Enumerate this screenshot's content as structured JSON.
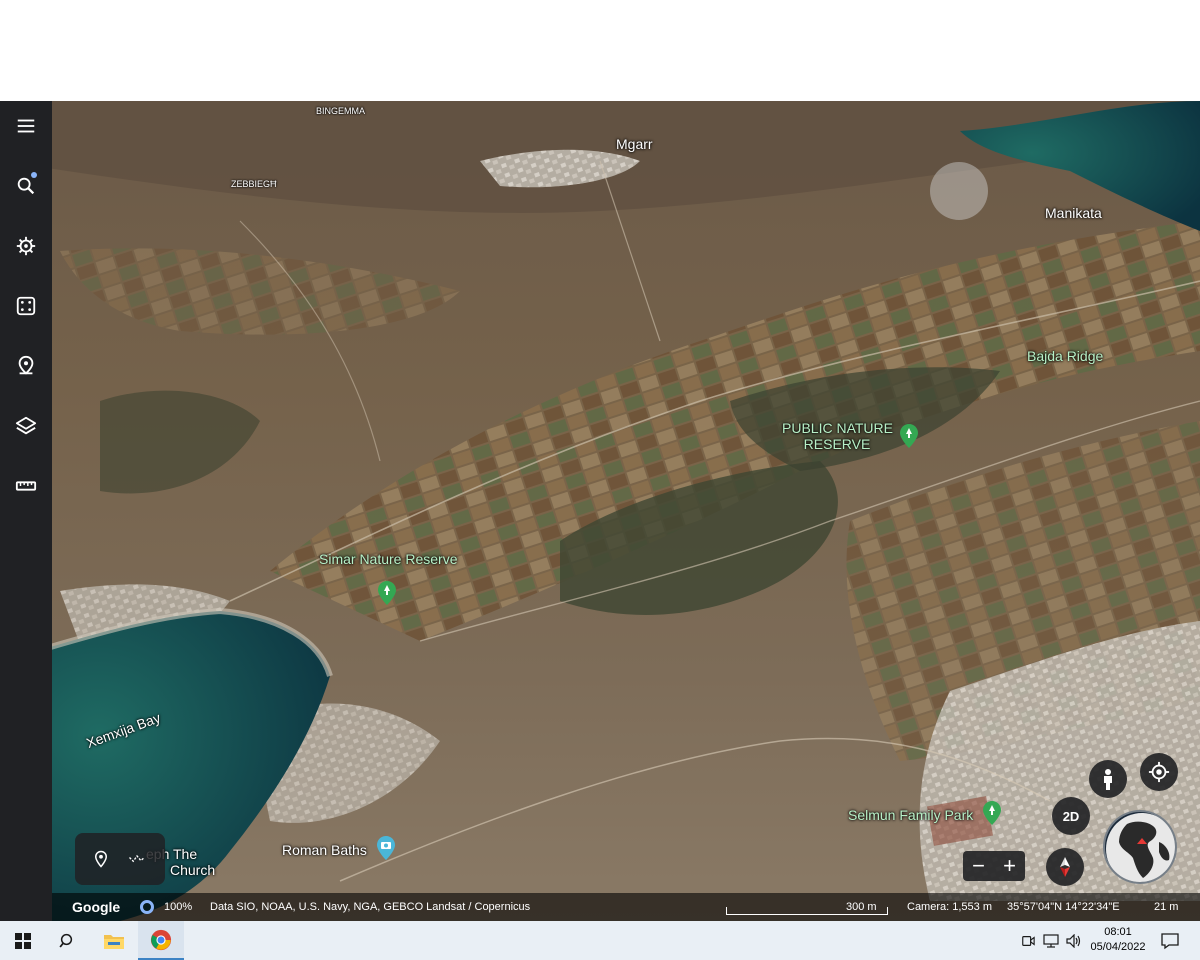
{
  "map": {
    "places": {
      "bingemma": "BINGEMMA",
      "mgarr": "Mgarr",
      "zebbiegh": "ZEBBIEGĦ",
      "manikata": "Manikata",
      "bajda": "Bajda Ridge",
      "public_reserve_line1": "PUBLIC NATURE",
      "public_reserve_line2": "RESERVE",
      "simar": "Simar Nature Reserve",
      "xemxija": "Xemxija Bay",
      "church_line1": "eph The",
      "church_line2": "Church",
      "roman_baths": "Roman Baths",
      "selmun": "Selmun Family Park"
    }
  },
  "sidebar": {
    "items": [
      {
        "icon": "menu-icon"
      },
      {
        "icon": "search-icon"
      },
      {
        "icon": "voyager-icon"
      },
      {
        "icon": "dice-icon"
      },
      {
        "icon": "projects-icon"
      },
      {
        "icon": "layers-icon"
      },
      {
        "icon": "ruler-icon"
      }
    ]
  },
  "controls": {
    "mode_2d": "2D",
    "zoom_out": "−",
    "zoom_in": "+"
  },
  "status": {
    "brand": "Google",
    "progress": "100%",
    "attribution": "Data SIO, NOAA, U.S. Navy, NGA, GEBCO  Landsat / Copernicus",
    "scale": "300 m",
    "camera": "Camera: 1,553 m",
    "coords": "35°57'04\"N 14°22'34\"E",
    "elevation": "21 m"
  },
  "taskbar": {
    "time": "08:01",
    "date": "05/04/2022"
  },
  "colors": {
    "sidebar": "#202124",
    "park_label": "#b7f0c7",
    "pin_green": "#34a853",
    "taskbar": "#e9eff5"
  }
}
